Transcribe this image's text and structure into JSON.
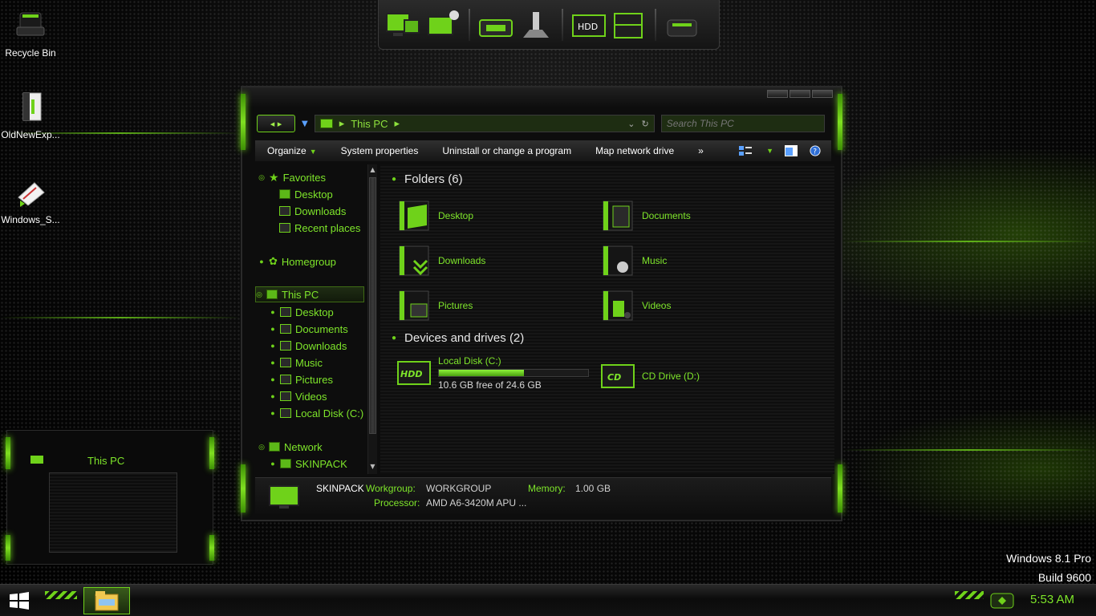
{
  "desktop": {
    "icons": [
      {
        "label": "Recycle Bin",
        "icon": "recycle-bin-icon"
      },
      {
        "label": "OldNewExp...",
        "icon": "app-icon"
      },
      {
        "label": "Windows_S...",
        "icon": "script-icon"
      }
    ],
    "os_info": {
      "line1": "Windows 8.1 Pro",
      "line2": "Build 9600"
    }
  },
  "dock": {
    "items": [
      "monitors-icon",
      "hardware-icon",
      "joystick-icon",
      "hdd-icon",
      "cube-drive-icon",
      "device-icon"
    ]
  },
  "explorer": {
    "address": "This PC",
    "search_placeholder": "Search This PC",
    "toolbar": {
      "organize": "Organize",
      "system_properties": "System properties",
      "uninstall": "Uninstall or change a program",
      "map_drive": "Map network drive",
      "more": "»"
    },
    "nav": {
      "favorites": "Favorites",
      "fav_items": [
        "Desktop",
        "Downloads",
        "Recent places"
      ],
      "homegroup": "Homegroup",
      "this_pc": "This PC",
      "pc_items": [
        "Desktop",
        "Documents",
        "Downloads",
        "Music",
        "Pictures",
        "Videos",
        "Local Disk (C:)"
      ],
      "network": "Network",
      "net_items": [
        "SKINPACK"
      ]
    },
    "folders_header": "Folders (6)",
    "folders": [
      "Desktop",
      "Documents",
      "Downloads",
      "Music",
      "Pictures",
      "Videos"
    ],
    "drives_header": "Devices and drives (2)",
    "drives": [
      {
        "name": "Local Disk (C:)",
        "free": "10.6 GB free of 24.6 GB",
        "used_fraction": 0.57
      },
      {
        "name": "CD Drive (D:)"
      }
    ],
    "details": {
      "computer": "SKINPACK",
      "workgroup_label": "Workgroup:",
      "workgroup": "WORKGROUP",
      "memory_label": "Memory:",
      "memory": "1.00 GB",
      "processor_label": "Processor:",
      "processor": "AMD A6-3420M APU ..."
    }
  },
  "thumbnail": {
    "title": "This PC"
  },
  "taskbar": {
    "clock": "5:53 AM"
  },
  "colors": {
    "accent": "#6fd21a",
    "text_green": "#7ee52a"
  }
}
